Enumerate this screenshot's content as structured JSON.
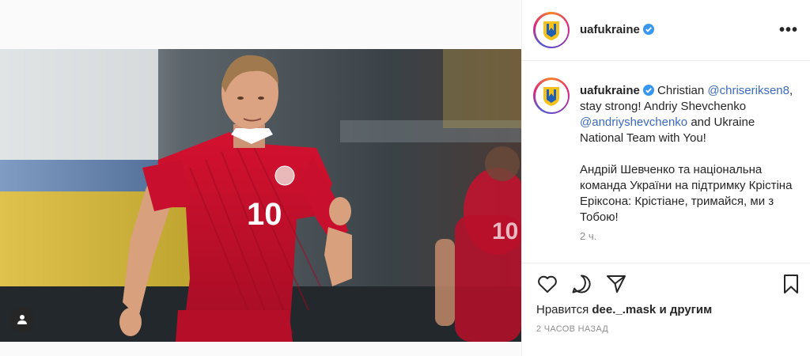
{
  "post": {
    "photo_jersey_number": "10",
    "photo_jersey_number_bg": "10"
  },
  "header": {
    "username": "uafukraine",
    "more_label": "•••"
  },
  "caption": {
    "username": "uafukraine",
    "text_1": "Christian",
    "mention_1": "@chriseriksen8",
    "text_2": ", stay strong! Andriy Shevchenko",
    "mention_2": "@andriyshevchenko",
    "text_3": "and Ukraine National Team with You!",
    "paragraph_ua": "Андрій Шевченко та національна команда України на підтримку Крістіна Еріксона: Крістіане, тримайся, ми з Тобою!",
    "time_ago": "2 ч."
  },
  "actions": {
    "likes_prefix": "Нравится",
    "likes_user": "dee._.mask",
    "likes_suffix": "и другим",
    "posted_ago": "2 часов назад"
  },
  "icons": {
    "like": "heart-icon",
    "comment": "comment-icon",
    "share": "send-icon",
    "save": "bookmark-icon",
    "tag": "user-tag-icon",
    "verified": "verified-badge-icon"
  },
  "colors": {
    "verified": "#3897f0",
    "mention": "#3b6bbd",
    "jersey": "#c8102e",
    "logo_blue": "#1f5fb4",
    "logo_yellow": "#f4c21b"
  }
}
